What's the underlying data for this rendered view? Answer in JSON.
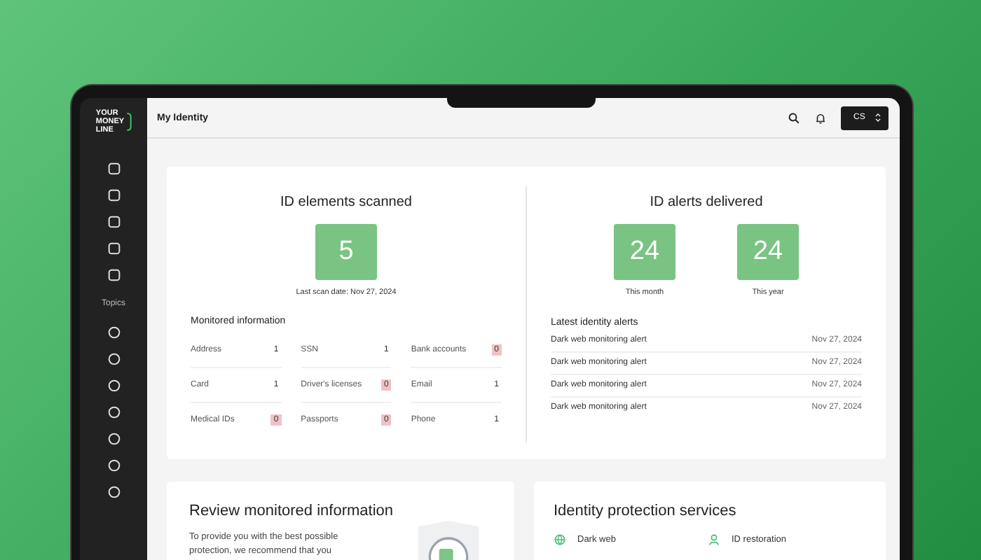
{
  "logo": {
    "lines": [
      "YOUR",
      "MONEY",
      "LINE"
    ]
  },
  "sidebar": {
    "section_label": "Topics"
  },
  "header": {
    "title": "My Identity",
    "account": "CS"
  },
  "scanned": {
    "title": "ID elements scanned",
    "count": "5",
    "last_scan": "Last scan date: Nov 27, 2024",
    "monitored_title": "Monitored information",
    "items": [
      {
        "label": "Address",
        "value": "1",
        "alert": false
      },
      {
        "label": "SSN",
        "value": "1",
        "alert": false
      },
      {
        "label": "Bank accounts",
        "value": "0",
        "alert": true
      },
      {
        "label": "Card",
        "value": "1",
        "alert": false
      },
      {
        "label": "Driver's licenses",
        "value": "0",
        "alert": true
      },
      {
        "label": "Email",
        "value": "1",
        "alert": false
      },
      {
        "label": "Medical IDs",
        "value": "0",
        "alert": true
      },
      {
        "label": "Passports",
        "value": "0",
        "alert": true
      },
      {
        "label": "Phone",
        "value": "1",
        "alert": false
      }
    ]
  },
  "alerts": {
    "title": "ID alerts delivered",
    "stats": [
      {
        "value": "24",
        "label": "This month"
      },
      {
        "value": "24",
        "label": "This year"
      }
    ],
    "latest_title": "Latest identity alerts",
    "rows": [
      {
        "name": "Dark web monitoring alert",
        "date": "Nov 27, 2024"
      },
      {
        "name": "Dark web monitoring alert",
        "date": "Nov 27, 2024"
      },
      {
        "name": "Dark web monitoring alert",
        "date": "Nov 27, 2024"
      },
      {
        "name": "Dark web monitoring alert",
        "date": "Nov 27, 2024"
      }
    ]
  },
  "review": {
    "title": "Review monitored information",
    "text": "To provide you with the best possible protection, we recommend that you"
  },
  "services": {
    "title": "Identity protection services",
    "items": [
      {
        "kind": "globe",
        "label": "Dark web"
      },
      {
        "kind": "person",
        "label": "ID restoration"
      }
    ]
  }
}
